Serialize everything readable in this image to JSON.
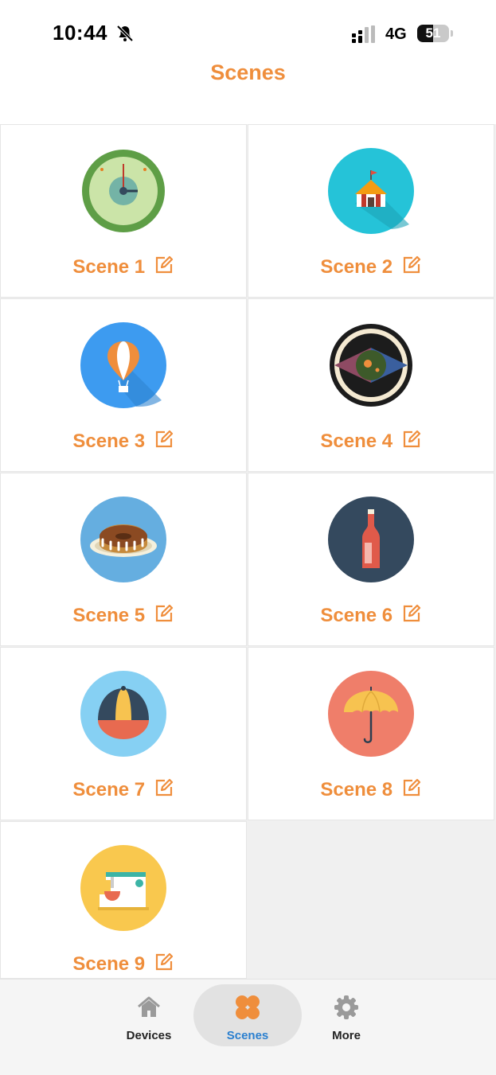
{
  "status_bar": {
    "time": "10:44",
    "network": "4G",
    "battery": "51",
    "battery_level": 0.51
  },
  "header": {
    "title": "Scenes"
  },
  "scenes": [
    {
      "label": "Scene 1",
      "icon": "clock-icon"
    },
    {
      "label": "Scene 2",
      "icon": "circus-tent-icon"
    },
    {
      "label": "Scene 3",
      "icon": "hot-air-balloon-icon"
    },
    {
      "label": "Scene 4",
      "icon": "eye-icon"
    },
    {
      "label": "Scene 5",
      "icon": "cake-icon"
    },
    {
      "label": "Scene 6",
      "icon": "bottle-icon"
    },
    {
      "label": "Scene 7",
      "icon": "cap-icon"
    },
    {
      "label": "Scene 8",
      "icon": "umbrella-icon"
    },
    {
      "label": "Scene 9",
      "icon": "sewing-machine-icon"
    }
  ],
  "tabs": [
    {
      "label": "Devices",
      "icon": "home-icon",
      "active": false
    },
    {
      "label": "Scenes",
      "icon": "scenes-icon",
      "active": true
    },
    {
      "label": "More",
      "icon": "gear-icon",
      "active": false
    }
  ],
  "colors": {
    "accent": "#ef8e3c",
    "active_tab_text": "#2a7fcf",
    "tab_bar_bg": "#f5f5f5",
    "active_tab_bg": "#e2e2e2"
  }
}
